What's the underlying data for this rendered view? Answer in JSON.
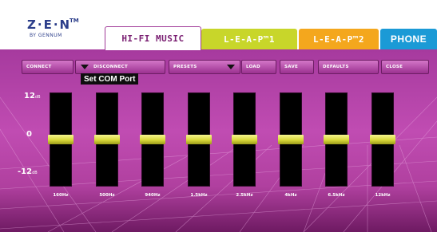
{
  "logo": {
    "main": "Z·E·N",
    "tm": "TM",
    "sub": "BY GENNUM"
  },
  "tabs": {
    "hifi": "HI-FI MUSIC",
    "leap1": "L-E-A-P™1",
    "leap2": "L-E-A-P™2",
    "phone": "PHONE"
  },
  "toolbar": {
    "connect": "CONNECT",
    "disconnect": "DISCONNECT",
    "presets": "PRESETS",
    "load": "LOAD",
    "save": "SAVE",
    "defaults": "DEFAULTS",
    "close": "CLOSE"
  },
  "tooltip": "Set COM Port",
  "scale": {
    "top": "12",
    "mid": "0",
    "bot": "-12",
    "unit": "dB"
  },
  "equalizer": {
    "bands": [
      {
        "freq": "160Hz",
        "gain_db": 0
      },
      {
        "freq": "500Hz",
        "gain_db": 0
      },
      {
        "freq": "940Hz",
        "gain_db": 0
      },
      {
        "freq": "1.5kHz",
        "gain_db": 0
      },
      {
        "freq": "2.5kHz",
        "gain_db": 0
      },
      {
        "freq": "4kHz",
        "gain_db": 0
      },
      {
        "freq": "6.5kHz",
        "gain_db": 0
      },
      {
        "freq": "12kHz",
        "gain_db": 0
      }
    ]
  },
  "icons": {
    "port_dropdown": "dropdown-arrow-icon",
    "presets_dropdown": "dropdown-arrow-icon"
  },
  "colors": {
    "panel": "#b444a8",
    "leap1": "#c8d62a",
    "leap2": "#f4a71d",
    "phone": "#1b9ad6",
    "knob": "#d9d83a"
  }
}
